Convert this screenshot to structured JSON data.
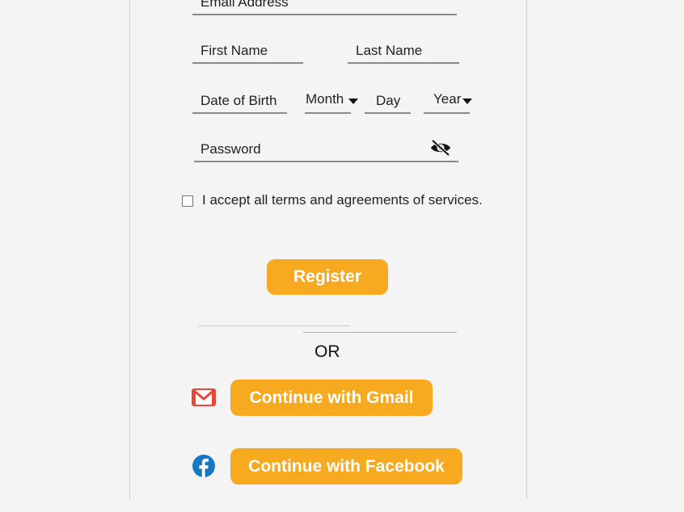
{
  "form": {
    "email_placeholder": "Email Address",
    "first_name_placeholder": "First Name",
    "last_name_placeholder": "Last Name",
    "dob_label": "Date of Birth",
    "month_label": "Month",
    "day_label": "Day",
    "year_label": "Year",
    "password_placeholder": "Password",
    "terms_text": "I accept all terms and agreements of services.",
    "terms_checked": false
  },
  "actions": {
    "register_label": "Register",
    "or_label": "OR",
    "gmail_label": "Continue with Gmail",
    "facebook_label": "Continue with Facebook"
  },
  "colors": {
    "accent": "#f7a920",
    "divider_left": "#f7c46a",
    "divider_right": "#a9a2f0",
    "gmail_red": "#e8453c",
    "facebook_blue": "#1877c2"
  },
  "icons": {
    "password_toggle": "eye-slash-icon",
    "gmail": "gmail-icon",
    "facebook": "facebook-icon",
    "dropdown": "caret-down-icon"
  }
}
